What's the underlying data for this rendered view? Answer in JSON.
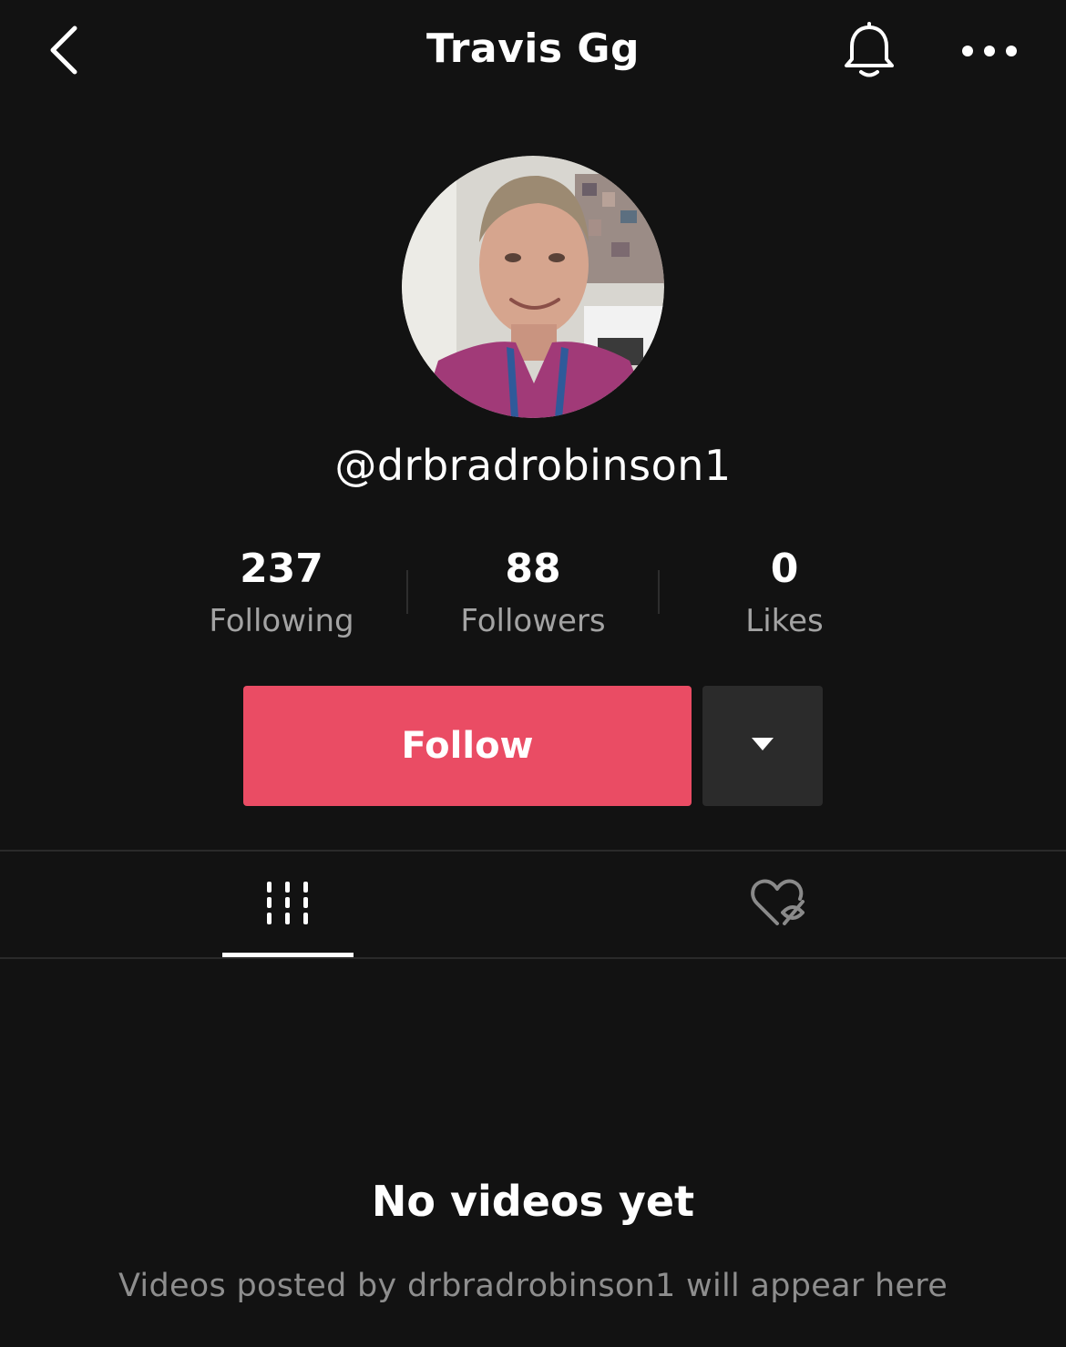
{
  "header": {
    "title": "Travis Gg",
    "back_icon": "chevron-left-icon",
    "bell_icon": "bell-icon",
    "more_icon": "more-horizontal-icon"
  },
  "profile": {
    "username": "@drbradrobinson1"
  },
  "stats": [
    {
      "value": "237",
      "label": "Following"
    },
    {
      "value": "88",
      "label": "Followers"
    },
    {
      "value": "0",
      "label": "Likes"
    }
  ],
  "actions": {
    "follow_label": "Follow",
    "dropdown_icon": "triangle-down-icon"
  },
  "tabs": {
    "videos_icon": "grid-columns-icon",
    "liked_icon": "heart-hidden-icon"
  },
  "empty_state": {
    "title": "No videos yet",
    "subtitle": "Videos posted by drbradrobinson1 will appear here"
  },
  "colors": {
    "background": "#121212",
    "follow_button": "#ea4c64",
    "secondary_button": "#2b2b2b",
    "muted_text": "#a3a3a3"
  }
}
